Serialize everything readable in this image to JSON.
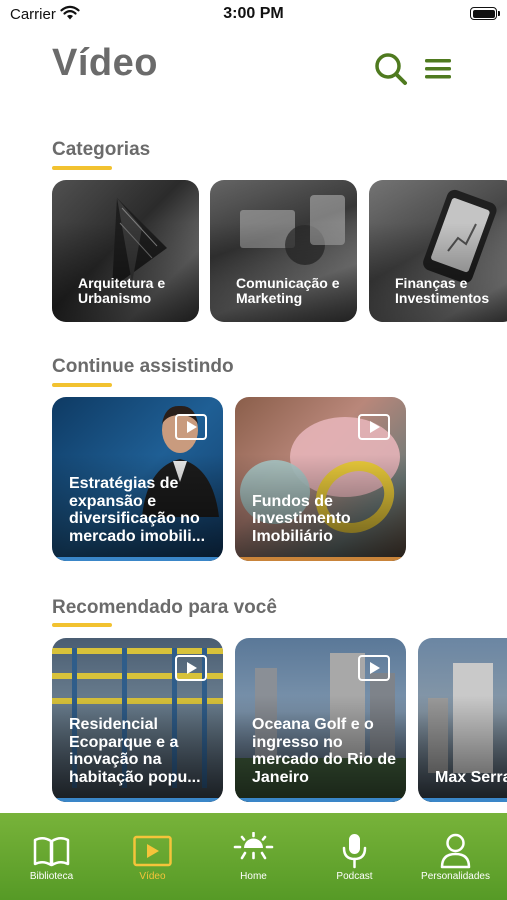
{
  "status_bar": {
    "carrier": "Carrier",
    "time": "3:00 PM"
  },
  "header": {
    "title": "Vídeo"
  },
  "sections": {
    "categories": {
      "title": "Categorias",
      "items": [
        {
          "label": "Arquitetura e Urbanismo"
        },
        {
          "label": "Comunicação e Marketing"
        },
        {
          "label": "Finanças e Investimentos"
        }
      ]
    },
    "continue": {
      "title": "Continue assistindo",
      "items": [
        {
          "title": "Estratégias de expansão e diversificação no mercado imobili...",
          "progress": 1.0
        },
        {
          "title": "Fundos de Investimento Imobiliário",
          "progress": 1.0
        }
      ]
    },
    "recommended": {
      "title": "Recomendado para você",
      "items": [
        {
          "title": "Residencial Ecoparque e a inovação na habitação popu...",
          "progress": 1.0
        },
        {
          "title": "Oceana Golf e o ingresso no mercado do Rio de Janeiro",
          "progress": 1.0
        },
        {
          "title": "Max Serra Dourada e a integração empreend...",
          "progress": 1.0
        }
      ]
    }
  },
  "tabs": [
    {
      "label": "Biblioteca",
      "icon": "book-icon"
    },
    {
      "label": "Vídeo",
      "icon": "video-play-icon",
      "active": true
    },
    {
      "label": "Home",
      "icon": "sun-home-icon"
    },
    {
      "label": "Podcast",
      "icon": "microphone-icon"
    },
    {
      "label": "Personalidades",
      "icon": "person-icon"
    }
  ],
  "colors": {
    "accent_green": "#4f7a1f",
    "tab_green": "#6aab30",
    "underline_yellow": "#f2c230",
    "progress_blue": "#3a86c8"
  }
}
